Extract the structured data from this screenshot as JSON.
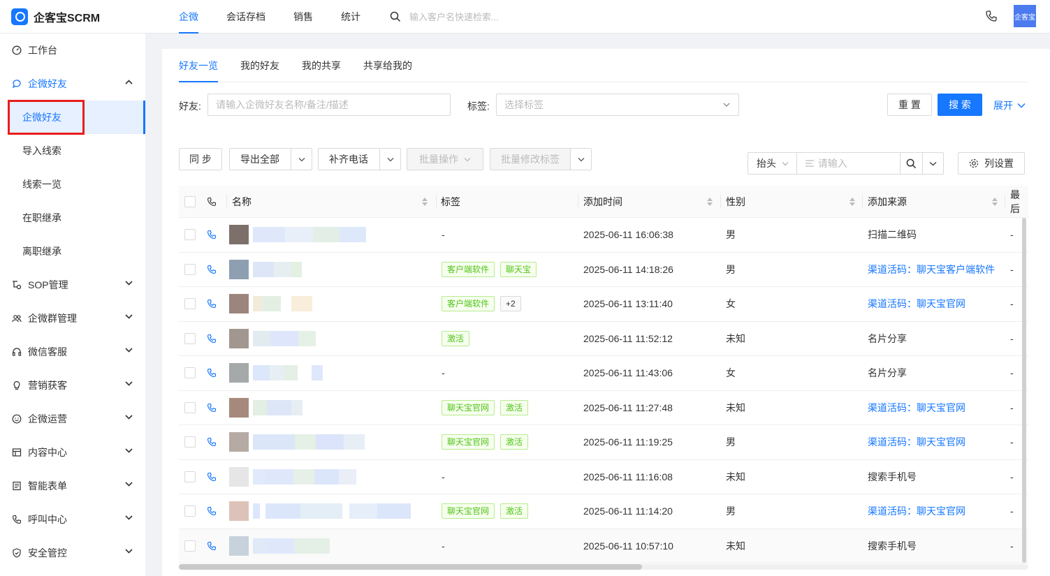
{
  "app": {
    "logo_text": "企客宝SCRM",
    "avatar_text": "企客宝"
  },
  "topnav": {
    "items": [
      "企微",
      "会话存档",
      "销售",
      "统计"
    ],
    "active_index": 0,
    "search_placeholder": "输入客户名快速检索..."
  },
  "sidebar": {
    "items": [
      {
        "label": "工作台",
        "icon": "dashboard-icon"
      },
      {
        "label": "企微好友",
        "icon": "chat-icon",
        "open": true
      },
      {
        "label": "SOP管理",
        "icon": "sop-icon"
      },
      {
        "label": "企微群管理",
        "icon": "group-icon"
      },
      {
        "label": "微信客服",
        "icon": "headset-icon"
      },
      {
        "label": "营销获客",
        "icon": "bulb-icon"
      },
      {
        "label": "企微运营",
        "icon": "smile-icon"
      },
      {
        "label": "内容中心",
        "icon": "content-icon"
      },
      {
        "label": "智能表单",
        "icon": "form-icon"
      },
      {
        "label": "呼叫中心",
        "icon": "phone-icon"
      },
      {
        "label": "安全管控",
        "icon": "shield-icon"
      }
    ],
    "subitems": [
      "企微好友",
      "导入线索",
      "线索一览",
      "在职继承",
      "离职继承"
    ],
    "active_sub_index": 0
  },
  "tabs": [
    "好友一览",
    "我的好友",
    "我的共享",
    "共享给我的"
  ],
  "filters": {
    "friend_label": "好友:",
    "friend_placeholder": "请输入企微好友名称/备注/描述",
    "tag_label": "标签:",
    "tag_placeholder": "选择标签",
    "reset": "重 置",
    "search": "搜 索",
    "expand": "展开"
  },
  "toolbar": {
    "sync": "同 步",
    "export_all": "导出全部",
    "fill_phone": "补齐电话",
    "batch_ops": "批量操作",
    "batch_tags": "批量修改标签",
    "header_select": "抬头",
    "search_placeholder": "请输入",
    "column_settings": "列设置"
  },
  "table": {
    "columns": [
      "名称",
      "标签",
      "添加时间",
      "性别",
      "添加来源",
      "最后"
    ],
    "rows": [
      {
        "avatar": "#7d706b",
        "tags": [],
        "time": "2025-06-11 16:06:38",
        "gender": "男",
        "source": "扫描二维码",
        "source_link": false,
        "last": "-"
      },
      {
        "avatar": "#8e9fb2",
        "tags": [
          "客户端软件",
          "聊天宝"
        ],
        "time": "2025-06-11 14:18:26",
        "gender": "男",
        "source": "渠道活码：聊天宝客户端软件",
        "source_link": true,
        "last": "-"
      },
      {
        "avatar": "#9b857c",
        "tags": [
          "客户端软件",
          "+2"
        ],
        "time": "2025-06-11 13:11:40",
        "gender": "女",
        "source": "渠道活码：聊天宝官网",
        "source_link": true,
        "last": "-"
      },
      {
        "avatar": "#a29790",
        "tags": [
          "激活"
        ],
        "time": "2025-06-11 11:52:12",
        "gender": "未知",
        "source": "名片分享",
        "source_link": false,
        "last": "-"
      },
      {
        "avatar": "#a5a9aa",
        "tags": [],
        "time": "2025-06-11 11:43:06",
        "gender": "女",
        "source": "名片分享",
        "source_link": false,
        "last": "-"
      },
      {
        "avatar": "#a6897a",
        "tags": [
          "聊天宝官网",
          "激活"
        ],
        "time": "2025-06-11 11:27:48",
        "gender": "未知",
        "source": "渠道活码：聊天宝官网",
        "source_link": true,
        "last": "-"
      },
      {
        "avatar": "#b6aaa5",
        "tags": [
          "聊天宝官网",
          "激活"
        ],
        "time": "2025-06-11 11:19:25",
        "gender": "男",
        "source": "渠道活码：聊天宝官网",
        "source_link": true,
        "last": "-"
      },
      {
        "avatar": "#e6e6e6",
        "tags": [],
        "time": "2025-06-11 11:16:08",
        "gender": "未知",
        "source": "搜索手机号",
        "source_link": false,
        "last": "-"
      },
      {
        "avatar": "#dcc2b9",
        "tags": [
          "聊天宝官网",
          "激活"
        ],
        "time": "2025-06-11 11:14:20",
        "gender": "男",
        "source": "渠道活码：聊天宝官网",
        "source_link": true,
        "last": "-"
      },
      {
        "avatar": "#c7d2dc",
        "tags": [],
        "time": "2025-06-11 10:57:10",
        "gender": "未知",
        "source": "搜索手机号",
        "source_link": false,
        "last": "-"
      }
    ]
  }
}
